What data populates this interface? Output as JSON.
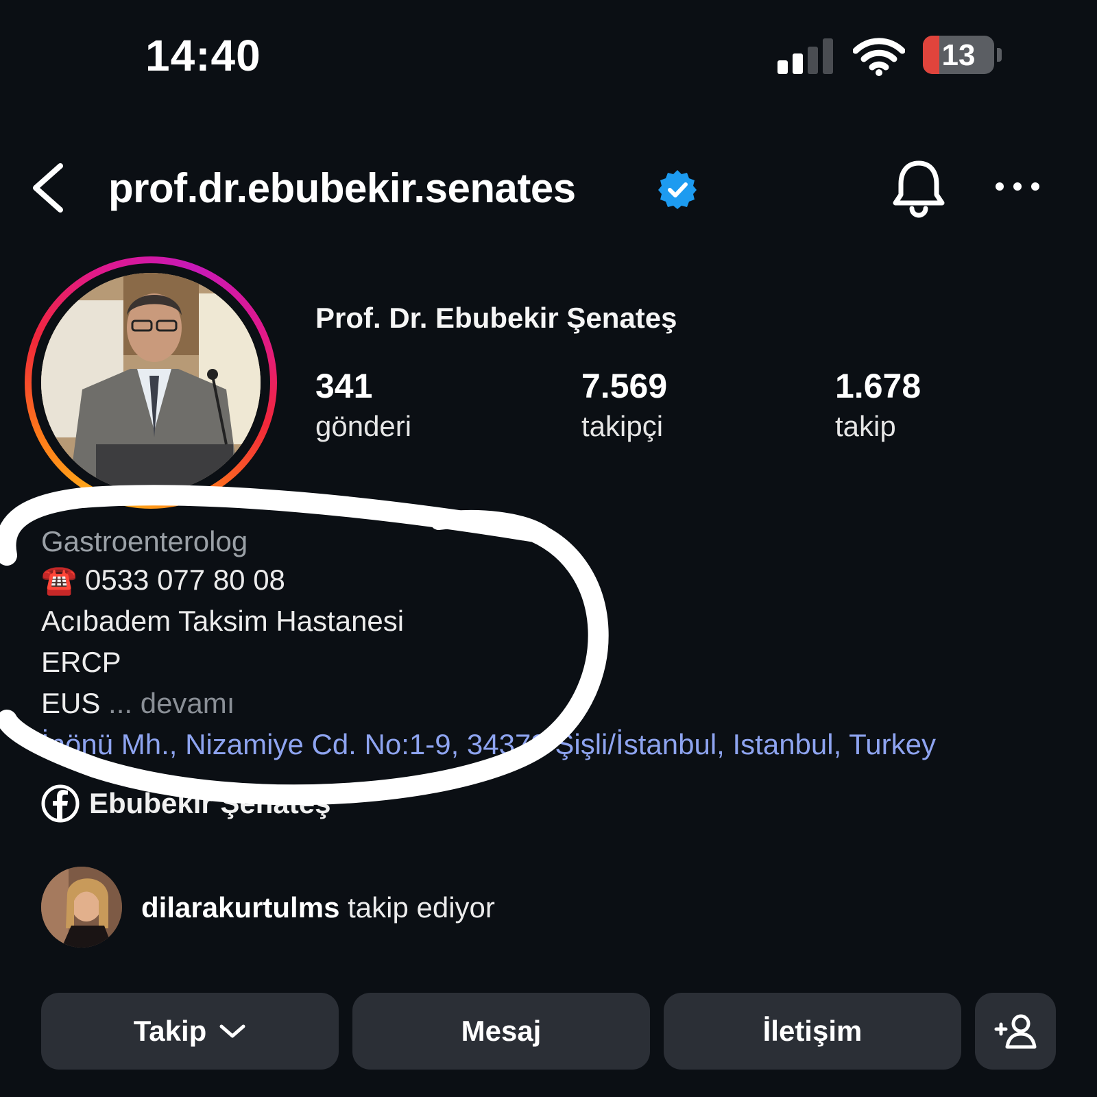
{
  "status_bar": {
    "time": "14:40",
    "battery_level": "13",
    "signal_bars_active": 2,
    "signal_bars_total": 4,
    "wifi_icon": "wifi-icon"
  },
  "header": {
    "back_icon": "chevron-left-icon",
    "username": "prof.dr.ebubekir.senates",
    "verified_icon": "verified-badge-icon",
    "bell_icon": "bell-icon",
    "more_icon": "more-horizontal-icon"
  },
  "profile": {
    "full_name": "Prof. Dr. Ebubekir Şenateş",
    "stats": [
      {
        "value": "341",
        "label": "gönderi"
      },
      {
        "value": "7.569",
        "label": "takipçi"
      },
      {
        "value": "1.678",
        "label": "takip"
      }
    ],
    "bio": {
      "category": "Gastroenterolog",
      "phone_emoji": "☎️",
      "phone": "0533 077 80 08",
      "hospital": "Acıbadem Taksim Hastanesi",
      "line_ercp": "ERCP",
      "line_eus": "EUS",
      "ellipsis": "...",
      "more": "devamı"
    },
    "address": "İnönü Mh., Nizamiye Cd. No:1-9, 34373 Şişli/İstanbul, Istanbul, Turkey",
    "facebook_name": "Ebubekir Şenateş",
    "followed_by_user": "dilarakurtulms",
    "followed_by_suffix": "takip ediyor"
  },
  "buttons": {
    "follow": "Takip",
    "message": "Mesaj",
    "contact": "İletişim",
    "add_person_icon": "add-person-icon"
  },
  "colors": {
    "background": "#0b0f14",
    "button_bg": "#2b2f36",
    "link": "#8ea4f0",
    "verified": "#1d9bf0",
    "battery_low": "#e0443c"
  }
}
